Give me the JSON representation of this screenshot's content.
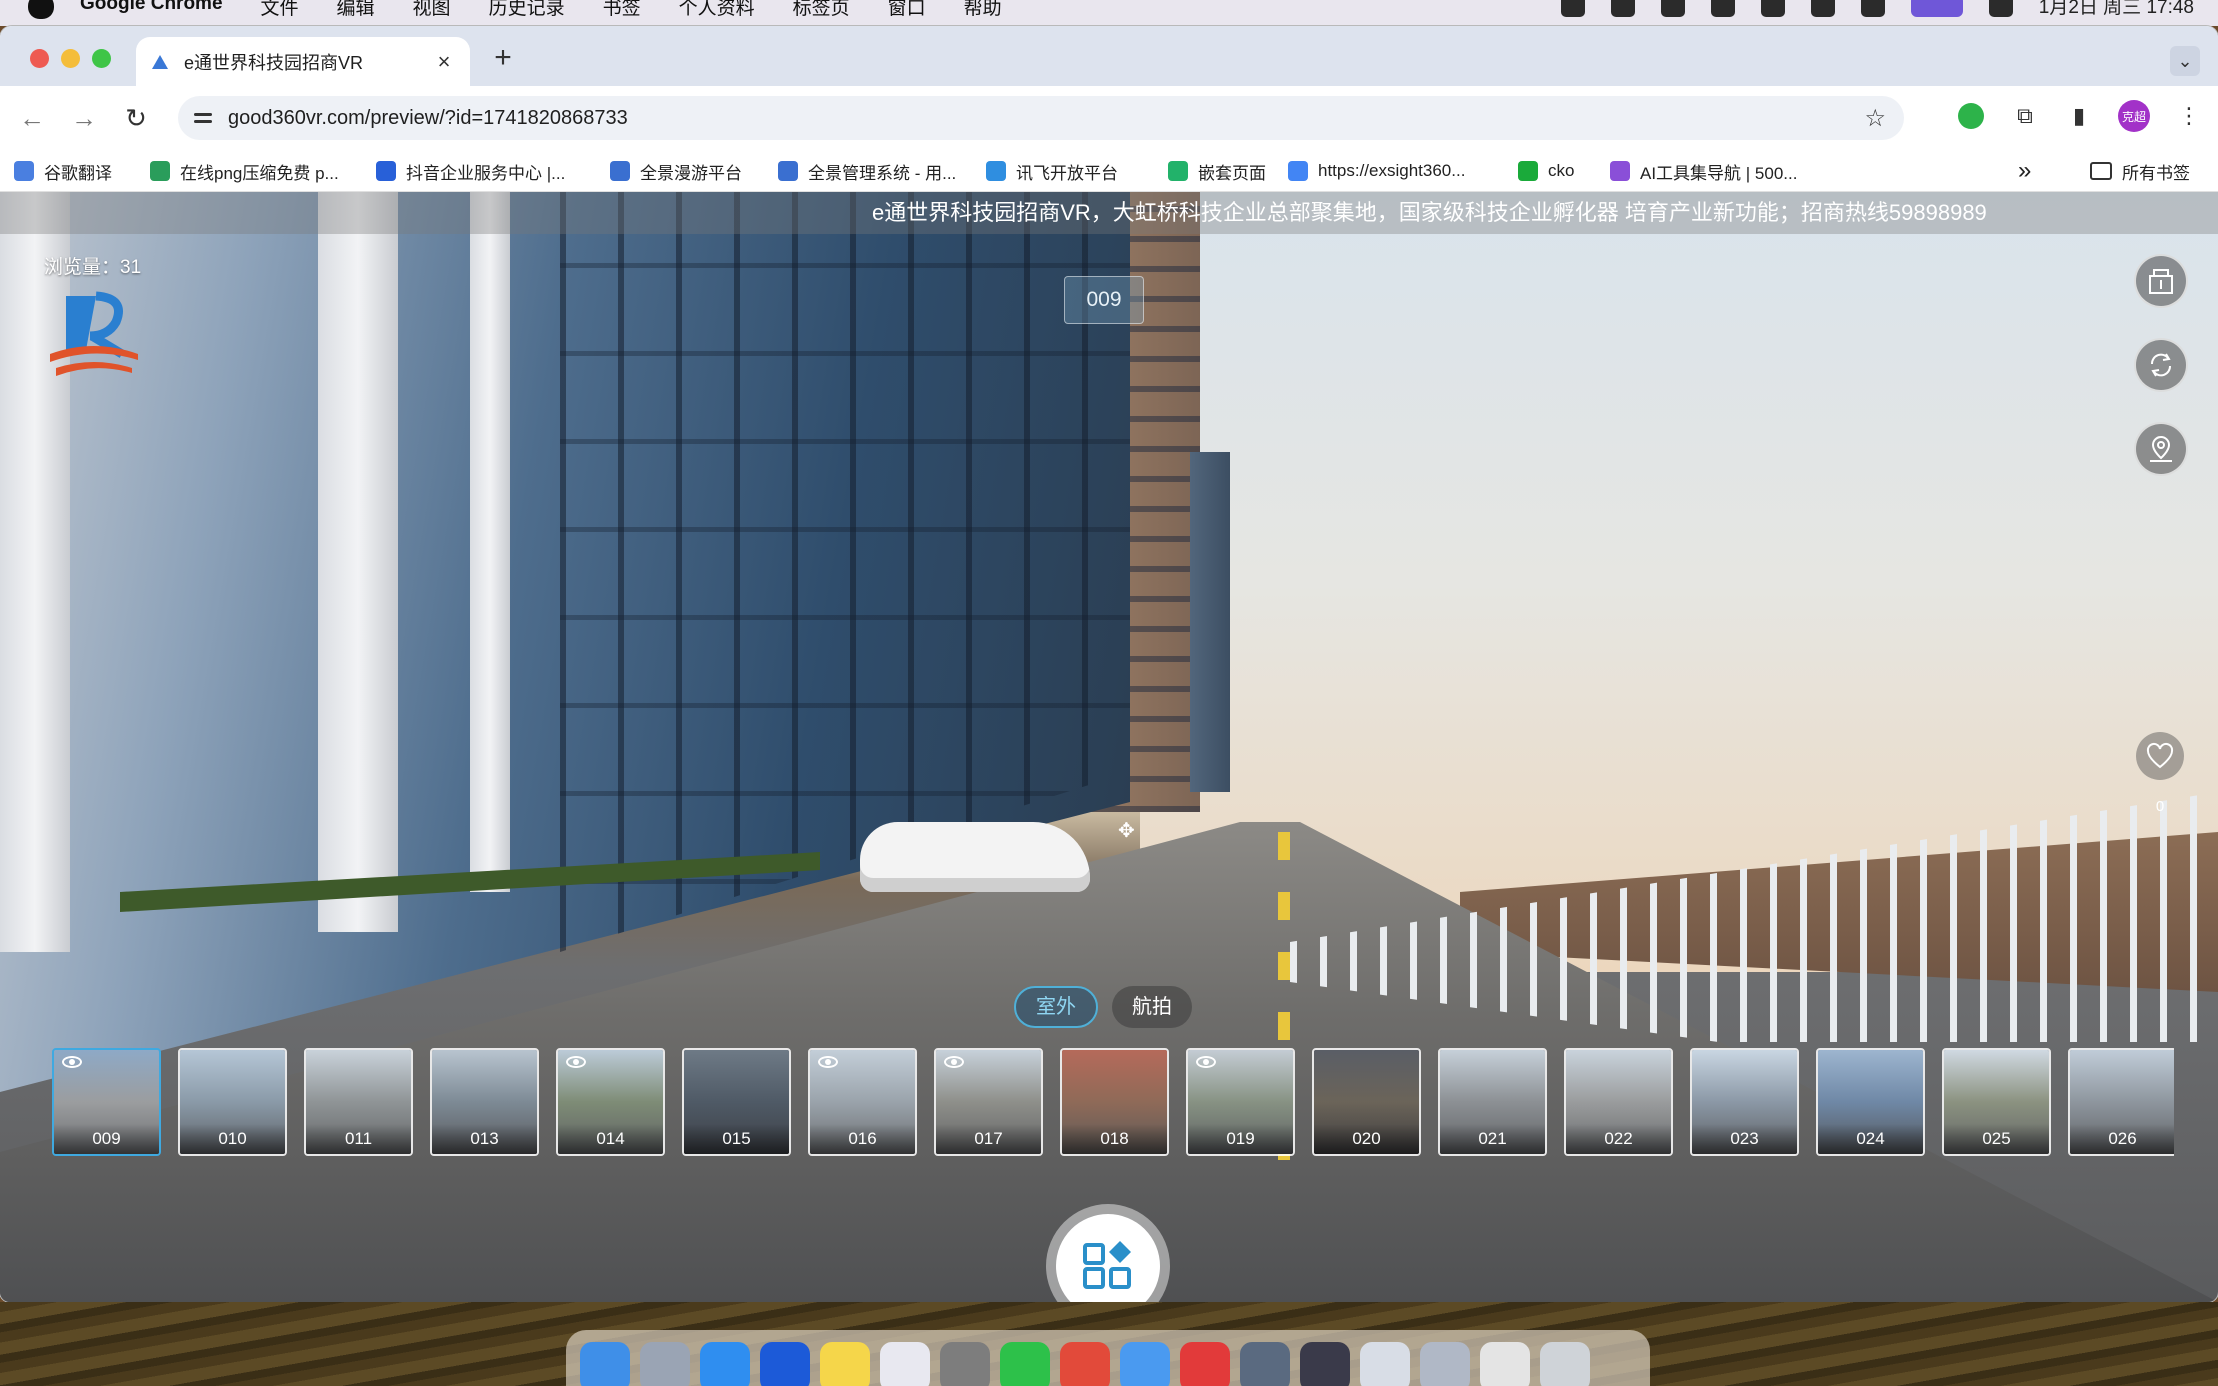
{
  "menubar": {
    "app": "Google Chrome",
    "items": [
      "文件",
      "编辑",
      "视图",
      "历史记录",
      "书签",
      "个人资料",
      "标签页",
      "窗口",
      "帮助"
    ],
    "clock": "1月2日 周三 17:48"
  },
  "browser": {
    "tab_title": "e通世界科技园招商VR",
    "tab_close": "×",
    "new_tab": "+",
    "url": "good360vr.com/preview/?id=1741820868733",
    "avatar_text": "克超",
    "bookmarks": [
      {
        "label": "谷歌翻译",
        "color": "#4a7fe0"
      },
      {
        "label": "在线png压缩免费 p...",
        "color": "#2a9d5b"
      },
      {
        "label": "抖音企业服务中心 |...",
        "color": "#2860d8"
      },
      {
        "label": "全景漫游平台",
        "color": "#3a6fd0"
      },
      {
        "label": "全景管理系统 - 用...",
        "color": "#3a6fd0"
      },
      {
        "label": "讯飞开放平台",
        "color": "#2f8ee0"
      },
      {
        "label": "嵌套页面",
        "color": "#22b26a"
      },
      {
        "label": "https://exsight360...",
        "color": "#4285f4"
      },
      {
        "label": "cko",
        "color": "#1aaa3a"
      },
      {
        "label": "AI工具集导航 | 500...",
        "color": "#8a4fd8"
      }
    ],
    "bookmarks_overflow": "»",
    "all_bookmarks": "所有书签"
  },
  "vr": {
    "marquee": "e通世界科技园招商VR，大虹桥科技企业总部聚集地，国家级科技企业孵化器 培育产业新功能；招商热线59898989",
    "views_label": "浏览量：31",
    "hotspot_label": "009",
    "like_count": "0",
    "categories": [
      {
        "label": "室外",
        "active": true
      },
      {
        "label": "航拍",
        "active": false
      }
    ],
    "scenes": [
      {
        "label": "009",
        "eye": true,
        "active": true
      },
      {
        "label": "010",
        "eye": false,
        "active": false
      },
      {
        "label": "011",
        "eye": false,
        "active": false
      },
      {
        "label": "013",
        "eye": false,
        "active": false
      },
      {
        "label": "014",
        "eye": true,
        "active": false
      },
      {
        "label": "015",
        "eye": false,
        "active": false
      },
      {
        "label": "016",
        "eye": true,
        "active": false
      },
      {
        "label": "017",
        "eye": true,
        "active": false
      },
      {
        "label": "018",
        "eye": false,
        "active": false
      },
      {
        "label": "019",
        "eye": true,
        "active": false
      },
      {
        "label": "020",
        "eye": false,
        "active": false
      },
      {
        "label": "021",
        "eye": false,
        "active": false
      },
      {
        "label": "022",
        "eye": false,
        "active": false
      },
      {
        "label": "023",
        "eye": false,
        "active": false
      },
      {
        "label": "024",
        "eye": false,
        "active": false
      },
      {
        "label": "025",
        "eye": false,
        "active": false
      },
      {
        "label": "026",
        "eye": false,
        "active": false
      }
    ]
  }
}
